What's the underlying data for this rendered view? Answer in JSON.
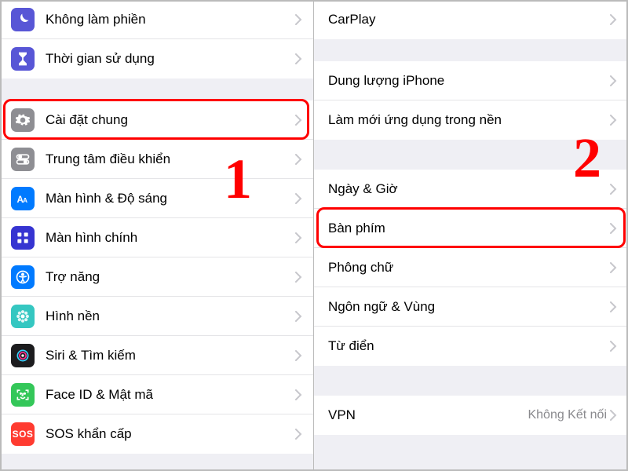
{
  "left": {
    "step_number": "1",
    "items": [
      {
        "id": "dnd",
        "label": "Không làm phiền"
      },
      {
        "id": "screentime",
        "label": "Thời gian sử dụng"
      },
      {
        "id": "general",
        "label": "Cài đặt chung",
        "highlight": true
      },
      {
        "id": "control",
        "label": "Trung tâm điều khiển"
      },
      {
        "id": "display",
        "label": "Màn hình & Độ sáng"
      },
      {
        "id": "home",
        "label": "Màn hình chính"
      },
      {
        "id": "access",
        "label": "Trợ năng"
      },
      {
        "id": "wallpaper",
        "label": "Hình nền"
      },
      {
        "id": "siri",
        "label": "Siri & Tìm kiếm"
      },
      {
        "id": "faceid",
        "label": "Face ID & Mật mã"
      },
      {
        "id": "sos",
        "label": "SOS khẩn cấp"
      }
    ]
  },
  "right": {
    "step_number": "2",
    "items": [
      {
        "id": "carplay",
        "label": "CarPlay"
      },
      {
        "id": "storage",
        "label": "Dung lượng iPhone"
      },
      {
        "id": "bgapp",
        "label": "Làm mới ứng dụng trong nền"
      },
      {
        "id": "datetime",
        "label": "Ngày & Giờ"
      },
      {
        "id": "keyboard",
        "label": "Bàn phím",
        "highlight": true
      },
      {
        "id": "fonts",
        "label": "Phông chữ"
      },
      {
        "id": "lang",
        "label": "Ngôn ngữ & Vùng"
      },
      {
        "id": "dict",
        "label": "Từ điển"
      },
      {
        "id": "vpn",
        "label": "VPN",
        "value": "Không Kết nối"
      }
    ]
  }
}
